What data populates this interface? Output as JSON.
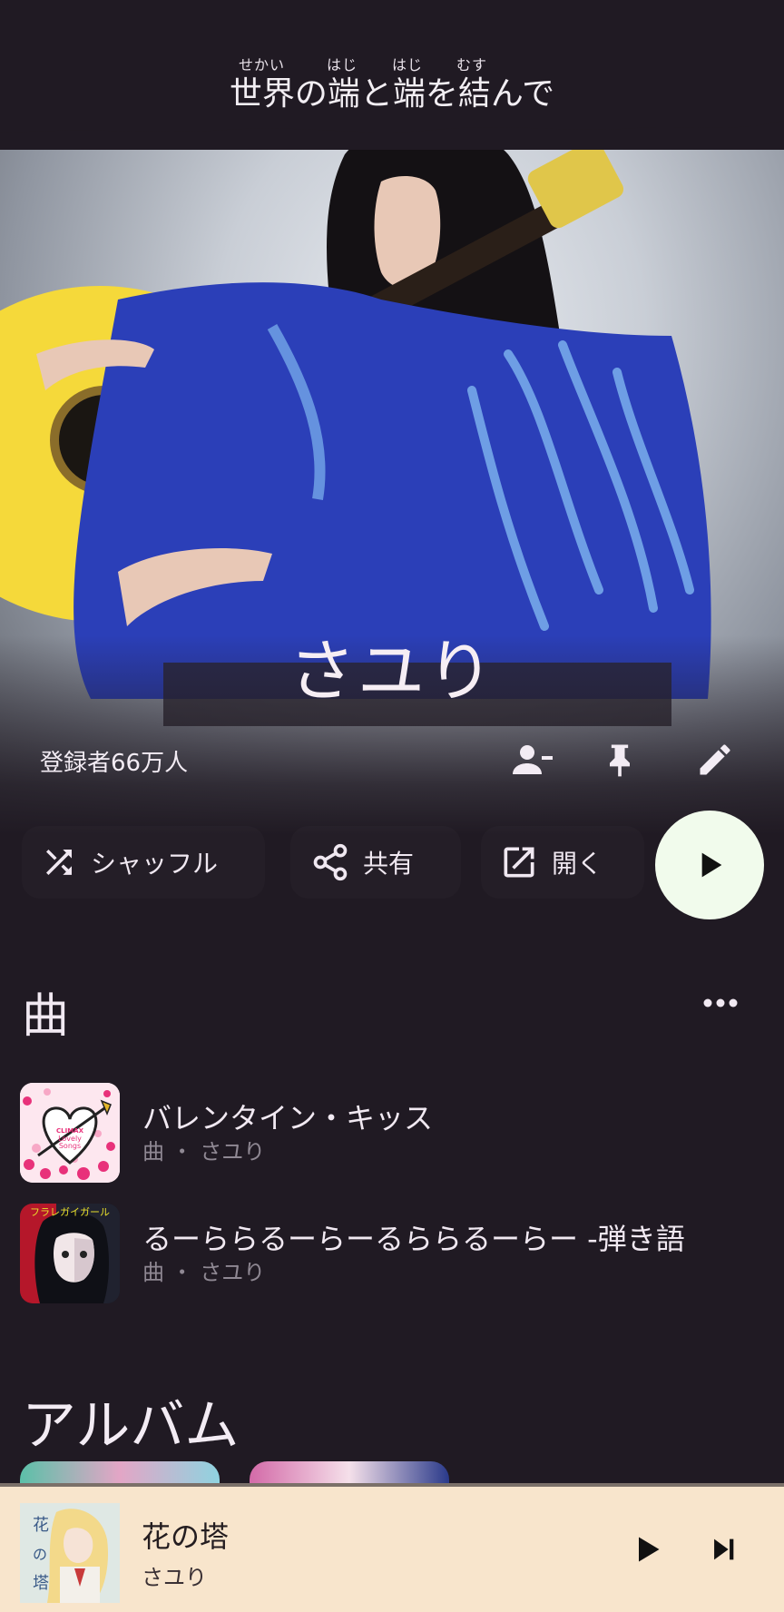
{
  "lyrics": {
    "ruby": [
      "せかい",
      "はじ",
      "はじ",
      "むす"
    ],
    "line": "世界の端と端を結んで"
  },
  "artist": {
    "name": "さユり",
    "subscribers": "登録者66万人"
  },
  "actions": {
    "shuffle": "シャッフル",
    "share": "共有",
    "open": "開く"
  },
  "songs_section": {
    "title": "曲",
    "items": [
      {
        "title": "バレンタイン・キッス",
        "subtitle": "曲 ・ さユり",
        "art_text": "CLIMAX Lovely Songs"
      },
      {
        "title": "るーららるーらーるららるーらー -弾き語",
        "subtitle": "曲 ・ さユり",
        "art_text": "フラレガイガール"
      }
    ]
  },
  "albums_section": {
    "title": "アルバム"
  },
  "mini_player": {
    "title": "花の塔",
    "artist": "さユり",
    "art_text": "花の塔"
  },
  "icons": {
    "unsubscribe": "person-remove-icon",
    "pin": "pin-icon",
    "edit": "pencil-icon",
    "shuffle": "shuffle-icon",
    "share": "share-icon",
    "open": "open-external-icon",
    "play": "play-icon",
    "more": "more-horizontal-icon",
    "next": "skip-next-icon"
  },
  "colors": {
    "background": "#201a23",
    "fab": "#f1fbec",
    "mini_player": "#f8e5cc"
  }
}
